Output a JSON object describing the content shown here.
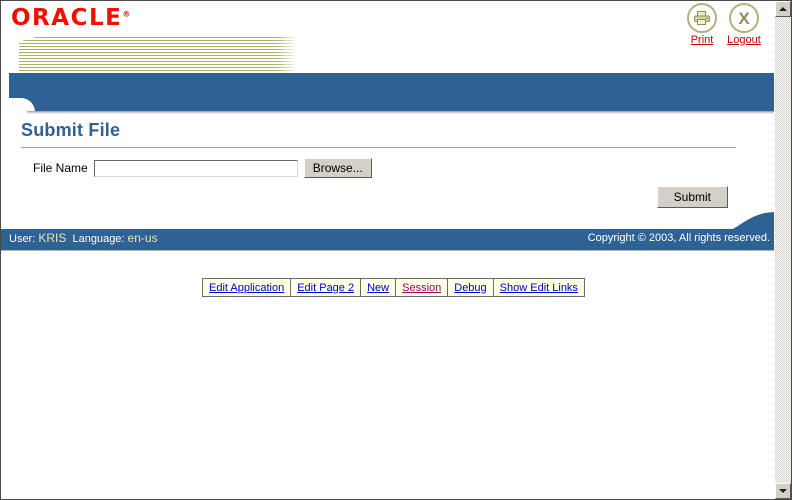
{
  "brand": {
    "logo_text": "ORACLE",
    "trademark": "®"
  },
  "utility": {
    "print": {
      "label": "Print",
      "icon": "printer-icon"
    },
    "logout": {
      "label": "Logout",
      "icon": "close-x-icon",
      "glyph": "X"
    }
  },
  "page": {
    "title": "Submit File"
  },
  "form": {
    "file_name_label": "File Name",
    "file_name_value": "",
    "file_name_placeholder": "",
    "browse_label": "Browse...",
    "submit_label": "Submit"
  },
  "footer": {
    "user_label": "User:",
    "user_value": "KRIS",
    "language_label": "Language:",
    "language_value": "en-us",
    "copyright": "Copyright © 2003, All rights reserved."
  },
  "dev_toolbar": {
    "items": [
      {
        "label": "Edit Application",
        "visited": false
      },
      {
        "label": "Edit Page 2",
        "visited": false
      },
      {
        "label": "New",
        "visited": false
      },
      {
        "label": "Session",
        "visited": true
      },
      {
        "label": "Debug",
        "visited": false
      },
      {
        "label": "Show Edit Links",
        "visited": false
      }
    ]
  },
  "colors": {
    "oracle_red": "#f01000",
    "header_blue": "#2e6295",
    "rule_olive": "#a8a566",
    "link_blue": "#0000cc",
    "link_visited": "#990066",
    "footer_value": "#e8e4b0"
  }
}
